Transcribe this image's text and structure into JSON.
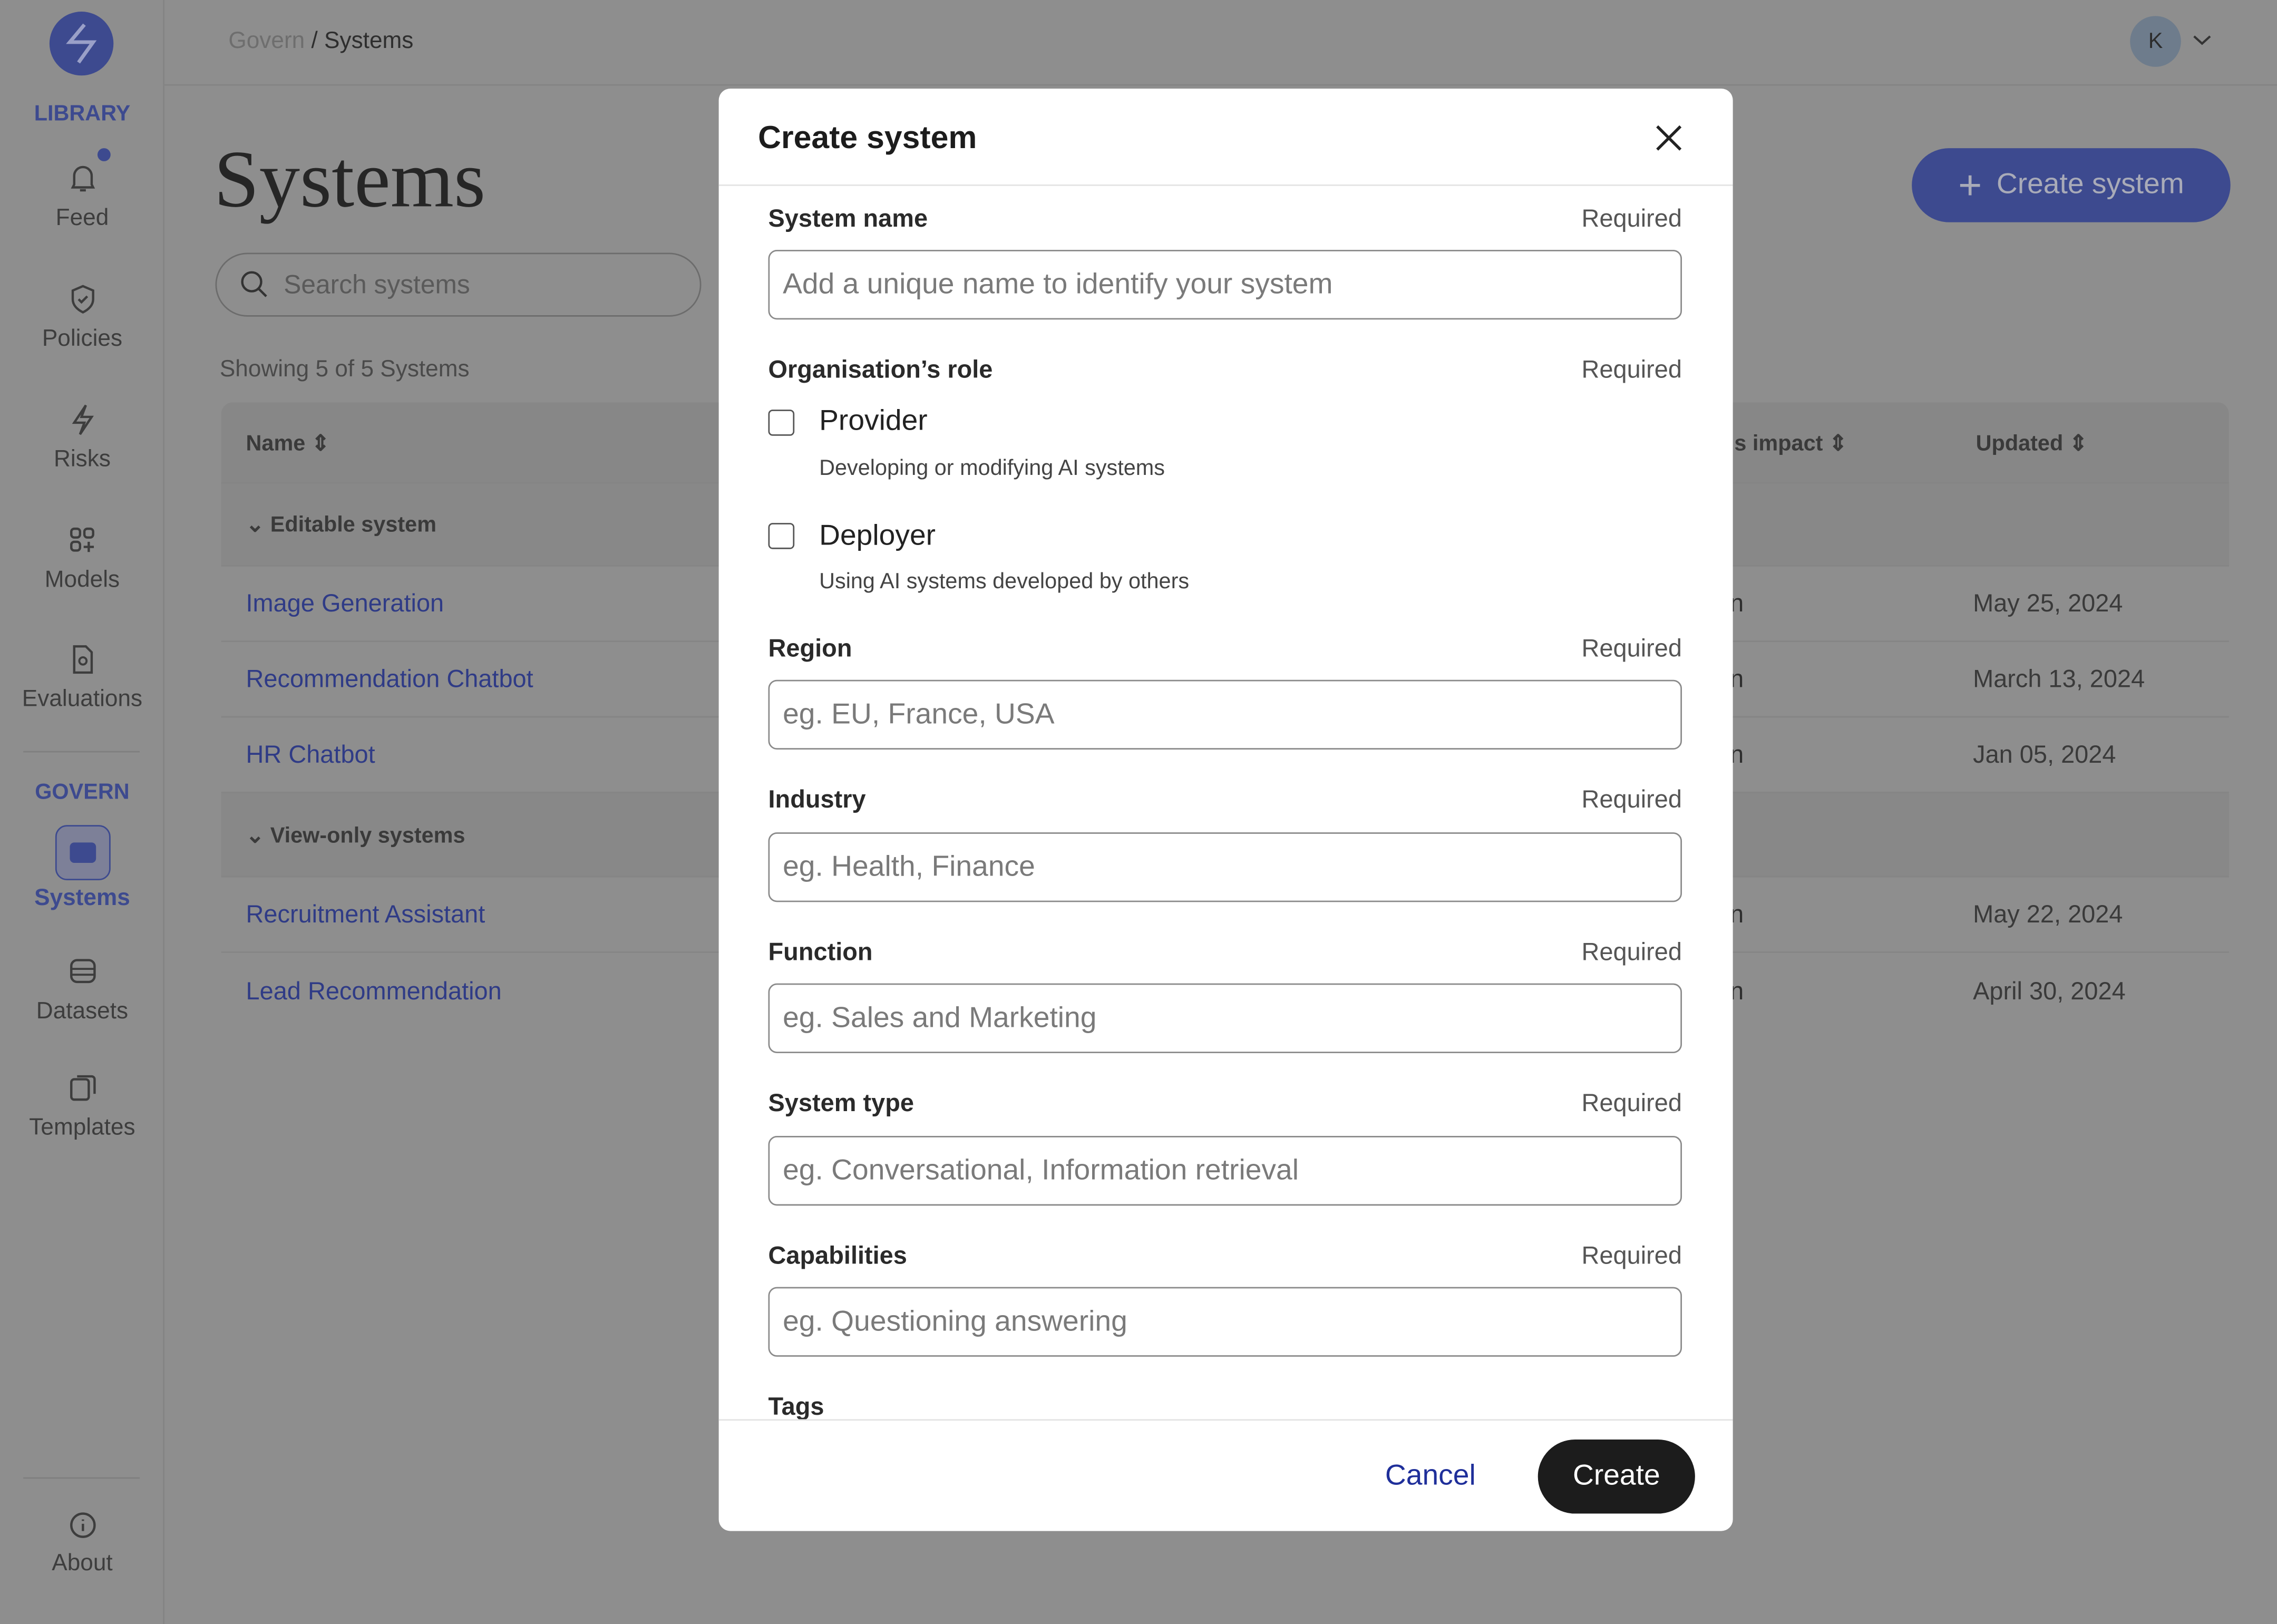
{
  "sidebar": {
    "library_label": "LIBRARY",
    "govern_label": "GOVERN",
    "items": [
      {
        "label": "Feed",
        "icon": "bell-icon"
      },
      {
        "label": "Policies",
        "icon": "shield-check-icon"
      },
      {
        "label": "Risks",
        "icon": "lightning-icon"
      },
      {
        "label": "Models",
        "icon": "grid-plus-icon"
      },
      {
        "label": "Evaluations",
        "icon": "document-search-icon"
      },
      {
        "label": "Systems",
        "icon": "box-icon",
        "active": true
      },
      {
        "label": "Datasets",
        "icon": "database-icon"
      },
      {
        "label": "Templates",
        "icon": "templates-icon"
      }
    ],
    "about": "About",
    "accent": "#3d4a8f"
  },
  "breadcrumb": {
    "parent": "Govern",
    "separator": " / ",
    "current": "Systems"
  },
  "user": {
    "initial": "K"
  },
  "page": {
    "title": "Systems",
    "search_placeholder": "Search systems",
    "showing": "Showing 5 of 5 Systems",
    "create_button": "Create system"
  },
  "table": {
    "columns": {
      "name": "Name",
      "impact": "s impact",
      "updated": "Updated"
    },
    "groups": [
      {
        "label": "Editable system",
        "rows": [
          {
            "name": "Image Generation",
            "impact": "n",
            "updated": "May 25, 2024"
          },
          {
            "name": "Recommendation Chatbot",
            "impact": "n",
            "updated": "March 13, 2024"
          },
          {
            "name": "HR Chatbot",
            "impact": "n",
            "updated": "Jan 05, 2024"
          }
        ]
      },
      {
        "label": "View-only systems",
        "rows": [
          {
            "name": "Recruitment Assistant",
            "impact": "n",
            "updated": "May 22, 2024"
          },
          {
            "name": "Lead Recommendation",
            "impact": "n",
            "updated": "April 30, 2024"
          }
        ]
      }
    ]
  },
  "modal": {
    "title": "Create system",
    "required": "Required",
    "system_name": {
      "label": "System name",
      "placeholder": "Add a unique name to identify your system"
    },
    "role": {
      "label": "Organisation’s role",
      "options": [
        {
          "label": "Provider",
          "desc": "Developing or modifying AI systems",
          "checked": false
        },
        {
          "label": "Deployer",
          "desc": "Using AI systems developed by others",
          "checked": false
        }
      ]
    },
    "region": {
      "label": "Region",
      "placeholder": "eg. EU, France, USA"
    },
    "industry": {
      "label": "Industry",
      "placeholder": "eg. Health, Finance"
    },
    "function": {
      "label": "Function",
      "placeholder": "eg. Sales and Marketing"
    },
    "system_type": {
      "label": "System type",
      "placeholder": "eg. Conversational, Information retrieval"
    },
    "capabilities": {
      "label": "Capabilities",
      "placeholder": "eg. Questioning answering"
    },
    "tags": {
      "label": "Tags"
    },
    "cancel": "Cancel",
    "create": "Create"
  }
}
